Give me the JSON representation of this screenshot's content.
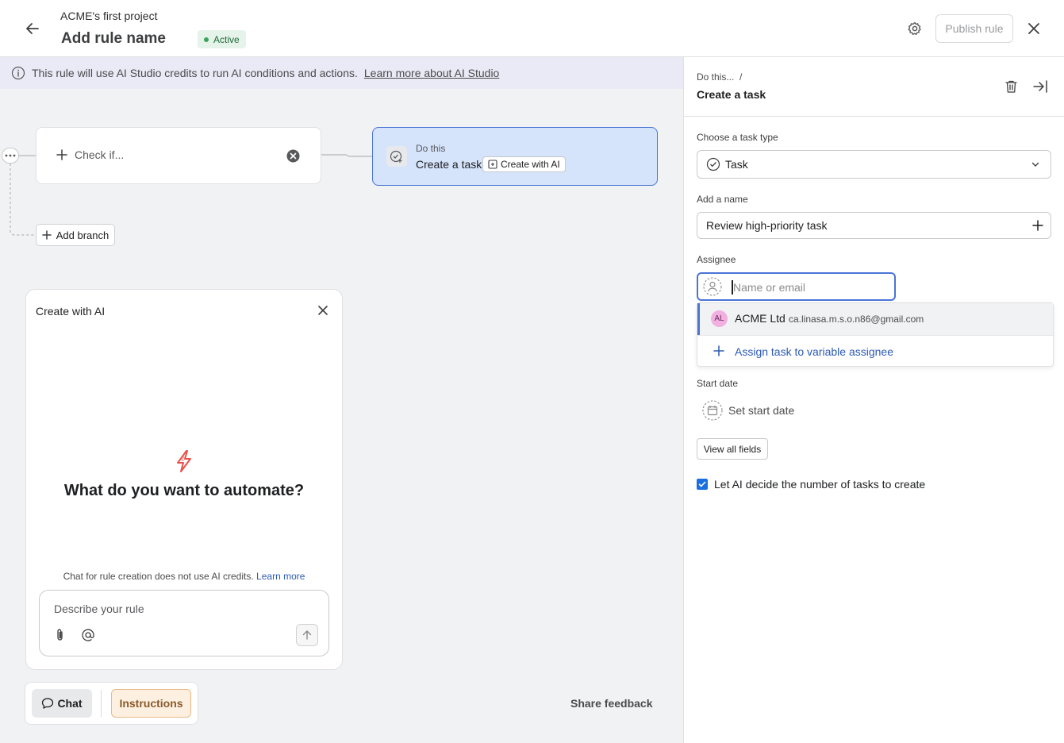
{
  "header": {
    "project_name": "ACME's first project",
    "rule_name": "Add rule name",
    "status": "Active",
    "publish_label": "Publish rule"
  },
  "info_bar": {
    "text": "This rule will use AI Studio credits to run AI conditions and actions.",
    "link": "Learn more about AI Studio"
  },
  "canvas": {
    "check_label": "Check if...",
    "do_caption": "Do this",
    "do_title": "Create a task",
    "do_ai_chip": "Create with AI",
    "add_branch": "Add branch"
  },
  "ai_panel": {
    "title": "Create with AI",
    "heading": "What do you want to automate?",
    "note": "Chat for rule creation does not use AI credits.",
    "note_link": "Learn more",
    "placeholder": "Describe your rule"
  },
  "tabs": {
    "chat": "Chat",
    "instructions": "Instructions",
    "share_feedback": "Share feedback"
  },
  "right_panel": {
    "breadcrumb": "Do this...  /",
    "title": "Create a task",
    "task_type_label": "Choose a task type",
    "task_type_value": "Task",
    "name_label": "Add a name",
    "name_value": "Review high-priority task",
    "assignee_label": "Assignee",
    "assignee_placeholder": "Name or email",
    "dropdown": {
      "avatar_initials": "AL",
      "name": "ACME Ltd",
      "email": "ca.linasa.m.s.o.n86@gmail.com",
      "variable_option": "Assign task to variable assignee"
    },
    "start_date_label": "Start date",
    "start_date_text": "Set start date",
    "view_all_fields": "View all fields",
    "ai_checkbox_label": "Let AI decide the number of tasks to create",
    "ai_checkbox_checked": true
  },
  "colors": {
    "accent": "#4a74d6",
    "link": "#2c5ab4",
    "status_green": "#3aa55a",
    "ai_bolt": "#e8504a"
  },
  "icons": [
    "back-arrow-icon",
    "gear-icon",
    "close-icon",
    "info-icon",
    "plus-icon",
    "clear-circle-icon",
    "more-dots-icon",
    "task-check-icon",
    "ai-create-icon",
    "bolt-icon",
    "paperclip-icon",
    "at-icon",
    "arrow-up-icon",
    "chat-bubble-icon",
    "trash-icon",
    "collapse-panel-icon",
    "chevron-down-icon",
    "user-placeholder-icon",
    "calendar-icon",
    "checkbox-check-icon"
  ]
}
